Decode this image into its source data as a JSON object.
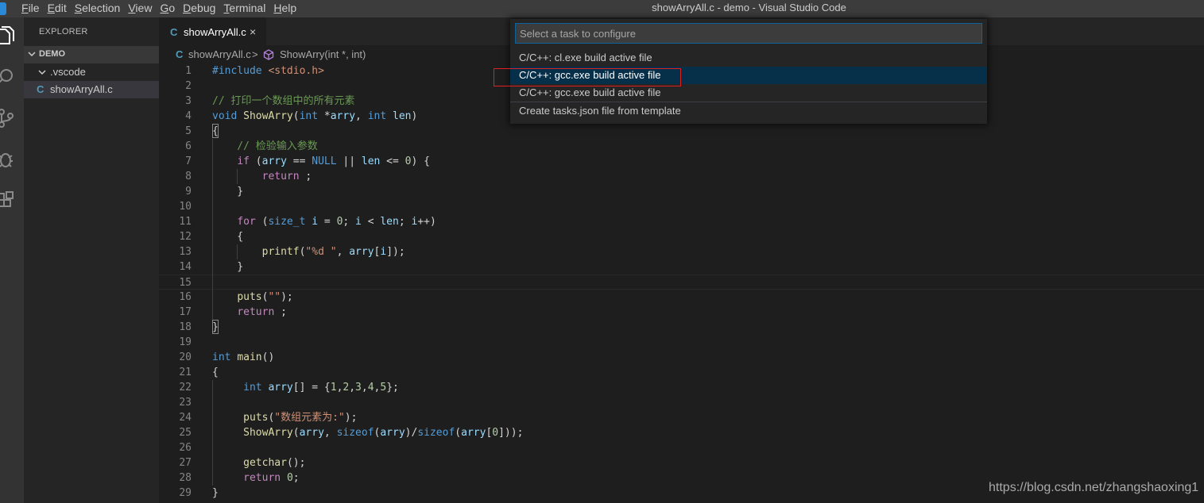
{
  "window": {
    "title": "showArryAll.c - demo - Visual Studio Code",
    "menu": [
      {
        "acc": "F",
        "rest": "ile"
      },
      {
        "acc": "E",
        "rest": "dit"
      },
      {
        "acc": "S",
        "rest": "election"
      },
      {
        "acc": "V",
        "rest": "iew"
      },
      {
        "acc": "G",
        "rest": "o"
      },
      {
        "acc": "D",
        "rest": "ebug"
      },
      {
        "acc": "T",
        "rest": "erminal"
      },
      {
        "acc": "H",
        "rest": "elp"
      }
    ]
  },
  "activity_bar": [
    "files-icon",
    "search-icon",
    "source-control-icon",
    "debug-icon",
    "extensions-icon"
  ],
  "sidebar": {
    "title": "EXPLORER",
    "section": "DEMO",
    "items": [
      {
        "label": ".vscode",
        "icon": "chevron-down-icon"
      },
      {
        "label": "showArryAll.c",
        "icon": "c-file-icon",
        "glyph": "C"
      }
    ]
  },
  "tab": {
    "glyph": "C",
    "label": "showArryAll.c",
    "close": "×"
  },
  "breadcrumb": {
    "glyph": "C",
    "file": "showArryAll.c",
    "separator": ">",
    "symbol": "ShowArry(int *, int)"
  },
  "editor": {
    "current_line": 15,
    "lines": [
      {
        "n": "1",
        "text": "#include <stdio.h>"
      },
      {
        "n": "2",
        "text": ""
      },
      {
        "n": "3",
        "text": "// 打印一个数组中的所有元素"
      },
      {
        "n": "4",
        "text": "void ShowArry(int *arry, int len)"
      },
      {
        "n": "5",
        "text": "{"
      },
      {
        "n": "6",
        "text": "    // 检验输入参数"
      },
      {
        "n": "7",
        "text": "    if (arry == NULL || len <= 0) {"
      },
      {
        "n": "8",
        "text": "        return ;"
      },
      {
        "n": "9",
        "text": "    }"
      },
      {
        "n": "10",
        "text": ""
      },
      {
        "n": "11",
        "text": "    for (size_t i = 0; i < len; i++)"
      },
      {
        "n": "12",
        "text": "    {"
      },
      {
        "n": "13",
        "text": "        printf(\"%d \", arry[i]);"
      },
      {
        "n": "14",
        "text": "    }"
      },
      {
        "n": "15",
        "text": ""
      },
      {
        "n": "16",
        "text": "    puts(\"\");"
      },
      {
        "n": "17",
        "text": "    return ;"
      },
      {
        "n": "18",
        "text": "}"
      },
      {
        "n": "19",
        "text": ""
      },
      {
        "n": "20",
        "text": "int main()"
      },
      {
        "n": "21",
        "text": "{"
      },
      {
        "n": "22",
        "text": "     int arry[] = {1,2,3,4,5};"
      },
      {
        "n": "23",
        "text": ""
      },
      {
        "n": "24",
        "text": "     puts(\"数组元素为:\");"
      },
      {
        "n": "25",
        "text": "     ShowArry(arry, sizeof(arry)/sizeof(arry[0]));"
      },
      {
        "n": "26",
        "text": ""
      },
      {
        "n": "27",
        "text": "     getchar();"
      },
      {
        "n": "28",
        "text": "     return 0;"
      },
      {
        "n": "29",
        "text": "}"
      }
    ]
  },
  "quick_pick": {
    "placeholder": "Select a task to configure",
    "focused_index": 1,
    "items": [
      "C/C++: cl.exe build active file",
      "C/C++: gcc.exe build active file",
      "C/C++: gcc.exe build active file",
      "Create tasks.json file from template"
    ]
  },
  "annotation": {
    "highlighted_item": "C/C++: gcc.exe build active file",
    "color": "#e02020"
  },
  "watermark": "https://blog.csdn.net/zhangshaoxing1",
  "colors": {
    "accent": "#0e639c",
    "focus": "#062f4a",
    "c_icon": "#519aba"
  }
}
